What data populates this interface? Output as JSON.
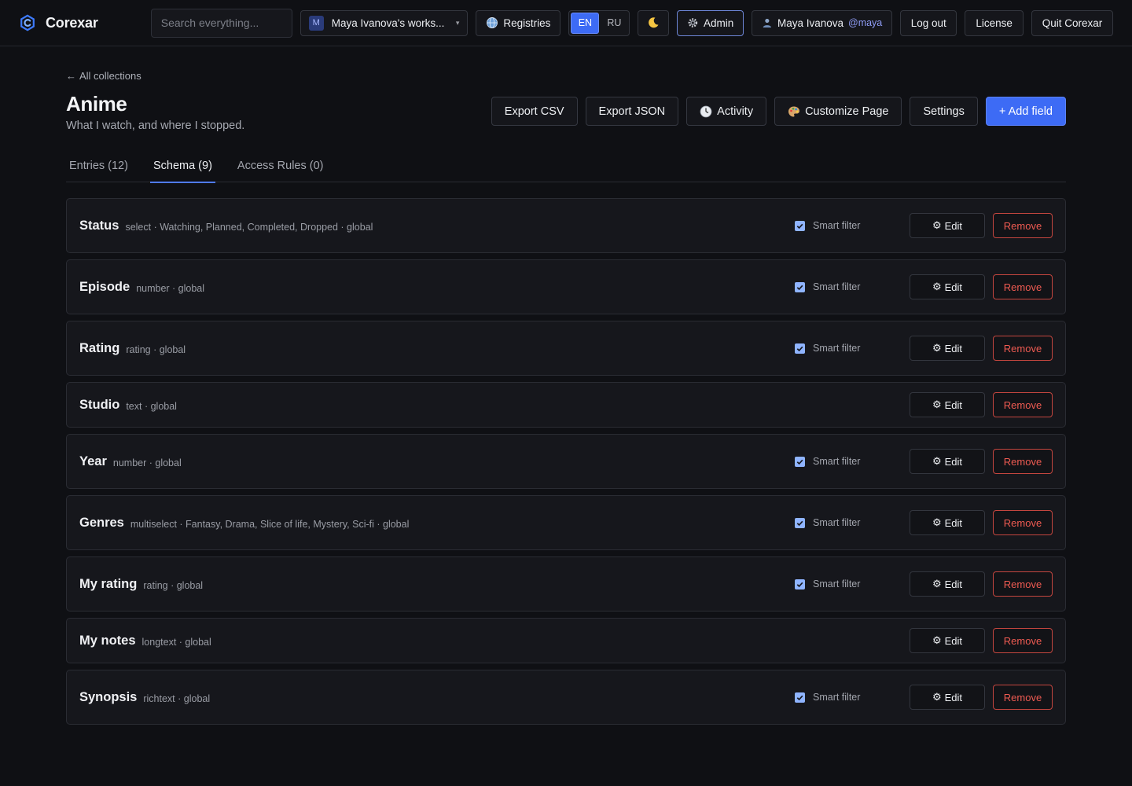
{
  "brand": {
    "name": "Corexar"
  },
  "header": {
    "search_placeholder": "Search everything...",
    "workspace": {
      "badge": "M",
      "label": "Maya Ivanova's works..."
    },
    "registries_label": "Registries",
    "languages": [
      {
        "code": "EN",
        "active": true
      },
      {
        "code": "RU",
        "active": false
      }
    ],
    "theme_icon": "moon-icon",
    "admin_label": "Admin",
    "user": {
      "name": "Maya Ivanova",
      "handle": "@maya"
    },
    "logout_label": "Log out",
    "license_label": "License",
    "quit_label": "Quit Corexar"
  },
  "page": {
    "back_label": "All collections",
    "title": "Anime",
    "subtitle": "What I watch, and where I stopped."
  },
  "actions": {
    "export_csv": "Export CSV",
    "export_json": "Export JSON",
    "activity": "Activity",
    "customize": "Customize Page",
    "settings": "Settings",
    "add_field": "+ Add field"
  },
  "tabs": [
    {
      "label": "Entries (12)",
      "active": false
    },
    {
      "label": "Schema (9)",
      "active": true
    },
    {
      "label": "Access Rules (0)",
      "active": false
    }
  ],
  "row_labels": {
    "smart_filter": "Smart filter",
    "edit": "Edit",
    "remove": "Remove"
  },
  "fields": [
    {
      "name": "Status",
      "meta": "select · Watching, Planned, Completed, Dropped · global",
      "smart_filter": true
    },
    {
      "name": "Episode",
      "meta": "number · global",
      "smart_filter": true
    },
    {
      "name": "Rating",
      "meta": "rating · global",
      "smart_filter": true
    },
    {
      "name": "Studio",
      "meta": "text · global",
      "smart_filter": false
    },
    {
      "name": "Year",
      "meta": "number · global",
      "smart_filter": true
    },
    {
      "name": "Genres",
      "meta": "multiselect · Fantasy, Drama, Slice of life, Mystery, Sci-fi · global",
      "smart_filter": true
    },
    {
      "name": "My rating",
      "meta": "rating · global",
      "smart_filter": true
    },
    {
      "name": "My notes",
      "meta": "longtext · global",
      "smart_filter": false
    },
    {
      "name": "Synopsis",
      "meta": "richtext · global",
      "smart_filter": true
    }
  ],
  "colors": {
    "accent": "#3d6bf5",
    "danger": "#ef5b52",
    "background": "#0f1014",
    "card": "#16171c"
  }
}
